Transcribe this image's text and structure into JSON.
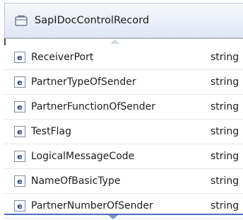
{
  "header": {
    "title": "SapIDocControlRecord",
    "icon": "folder-icon"
  },
  "elements": [
    {
      "name": "ReceiverPort",
      "type": "string",
      "badge": "e"
    },
    {
      "name": "PartnerTypeOfSender",
      "type": "string",
      "badge": "e"
    },
    {
      "name": "PartnerFunctionOfSender",
      "type": "string",
      "badge": "e"
    },
    {
      "name": "TestFlag",
      "type": "string",
      "badge": "e"
    },
    {
      "name": "LogicalMessageCode",
      "type": "string",
      "badge": "e"
    },
    {
      "name": "NameOfBasicType",
      "type": "string",
      "badge": "e"
    },
    {
      "name": "PartnerNumberOfSender",
      "type": "string",
      "badge": "e"
    }
  ]
}
